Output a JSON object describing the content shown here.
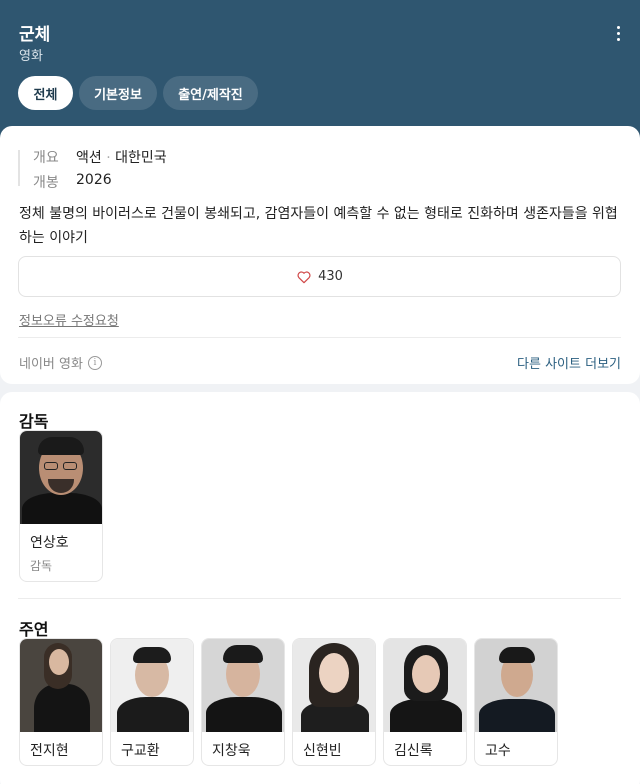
{
  "header": {
    "title": "군체",
    "subtitle": "영화",
    "tabs": [
      {
        "label": "전체",
        "active": true
      },
      {
        "label": "기본정보",
        "active": false
      },
      {
        "label": "출연/제작진",
        "active": false
      }
    ],
    "more_icon": "kebab-icon"
  },
  "info": {
    "overview_label": "개요",
    "genre": "액션",
    "country": "대한민국",
    "release_label": "개봉",
    "release_year": "2026",
    "synopsis": "정체 불명의 바이러스로 건물이 봉쇄되고, 감염자들이 예측할 수 없는 형태로 진화하며 생존자들을 위협하는 이야기",
    "like_count": "430",
    "error_report": "정보오류 수정요청",
    "source": "네이버 영화",
    "more_sites": "다른 사이트 더보기"
  },
  "crew": {
    "director_title": "감독",
    "director": {
      "name": "연상호",
      "role": "감독"
    },
    "cast_title": "주연",
    "cast": [
      {
        "name": "전지현"
      },
      {
        "name": "구교환"
      },
      {
        "name": "지창욱"
      },
      {
        "name": "신현빈"
      },
      {
        "name": "김신록"
      },
      {
        "name": "고수"
      }
    ]
  },
  "colors": {
    "header_bg": "#2f5670",
    "link": "#2b5f80",
    "heart": "#d04848"
  }
}
